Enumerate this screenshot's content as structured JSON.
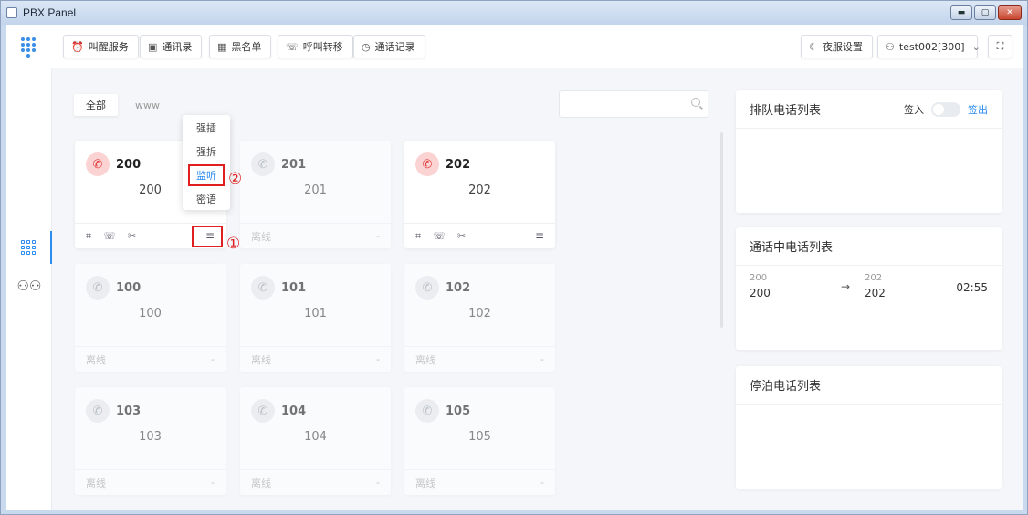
{
  "window": {
    "title": "PBX Panel",
    "min": "▬",
    "max": "▢",
    "close": "✕"
  },
  "toolbar": {
    "buttons": [
      {
        "label": "叫醒服务",
        "icon": "⏰"
      },
      {
        "label": "通讯录",
        "icon": "▣"
      },
      {
        "label": "黑名单",
        "icon": "▦"
      },
      {
        "label": "呼叫转移",
        "icon": "☏"
      },
      {
        "label": "通话记录",
        "icon": "◷"
      }
    ],
    "night_mode": {
      "label": "夜服设置",
      "icon": "☾"
    },
    "user": {
      "label": "test002[300]",
      "icon": "⚇",
      "chevron": "⌄"
    },
    "fullscreen_icon": "⛶"
  },
  "rail": {
    "users_icon": "⚇⚇"
  },
  "tabs": [
    "全部",
    "www"
  ],
  "search": {
    "placeholder": ""
  },
  "cards": [
    {
      "ext": "200",
      "name": "200",
      "status": "busy",
      "foot": ""
    },
    {
      "ext": "201",
      "name": "201",
      "status": "offline",
      "foot": "离线"
    },
    {
      "ext": "202",
      "name": "202",
      "status": "busy",
      "foot": ""
    },
    {
      "ext": "100",
      "name": "100",
      "status": "offline",
      "foot": "离线"
    },
    {
      "ext": "101",
      "name": "101",
      "status": "offline",
      "foot": "离线"
    },
    {
      "ext": "102",
      "name": "102",
      "status": "offline",
      "foot": "离线"
    },
    {
      "ext": "103",
      "name": "103",
      "status": "offline",
      "foot": "离线"
    },
    {
      "ext": "104",
      "name": "104",
      "status": "offline",
      "foot": "离线"
    },
    {
      "ext": "105",
      "name": "105",
      "status": "offline",
      "foot": "离线"
    }
  ],
  "card_icons": {
    "phone": "✆",
    "keypad": "⌗",
    "call": "☏",
    "hangup": "✂",
    "menu": "≡",
    "dash": "-"
  },
  "dropdown": [
    "强插",
    "强拆",
    "监听",
    "密语"
  ],
  "annotations": {
    "one": "①",
    "two": "②"
  },
  "panels": {
    "queue": {
      "title": "排队电话列表",
      "signin": "签入",
      "signout": "签出"
    },
    "active": {
      "title": "通话中电话列表",
      "calls": [
        {
          "from_small": "200",
          "from": "200",
          "arrow": "→",
          "to_small": "202",
          "to": "202",
          "duration": "02:55"
        }
      ]
    },
    "parked": {
      "title": "停泊电话列表"
    }
  }
}
